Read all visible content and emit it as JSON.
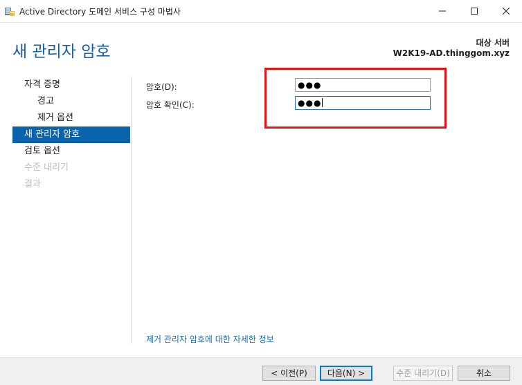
{
  "window": {
    "title": "Active Directory 도메인 서비스 구성 마법사",
    "icon": "server-wizard-icon"
  },
  "header": {
    "page_title": "새 관리자 암호",
    "target_label": "대상 서버",
    "target_server": "W2K19-AD.thinggom.xyz"
  },
  "nav": {
    "items": [
      {
        "label": "자격 증명",
        "state": "normal",
        "level": 0
      },
      {
        "label": "경고",
        "state": "normal",
        "level": 1
      },
      {
        "label": "제거 옵션",
        "state": "normal",
        "level": 1
      },
      {
        "label": "새 관리자 암호",
        "state": "active",
        "level": 0
      },
      {
        "label": "검토 옵션",
        "state": "normal",
        "level": 0
      },
      {
        "label": "수준 내리기",
        "state": "disabled",
        "level": 0
      },
      {
        "label": "결과",
        "state": "disabled",
        "level": 0
      }
    ]
  },
  "form": {
    "password_label": "암호(D):",
    "password_value": "●●●",
    "confirm_label": "암호 확인(C):",
    "confirm_value": "●●●"
  },
  "link": {
    "more_info": "제거 관리자 암호에 대한 자세한 정보"
  },
  "footer": {
    "prev": "< 이전(P)",
    "next": "다음(N) >",
    "demote": "수준 내리기(D)",
    "cancel": "취소"
  },
  "colors": {
    "accent": "#0a64ad",
    "title": "#1a5ea6",
    "highlight": "#ee1111",
    "link": "#1a6fb5"
  }
}
